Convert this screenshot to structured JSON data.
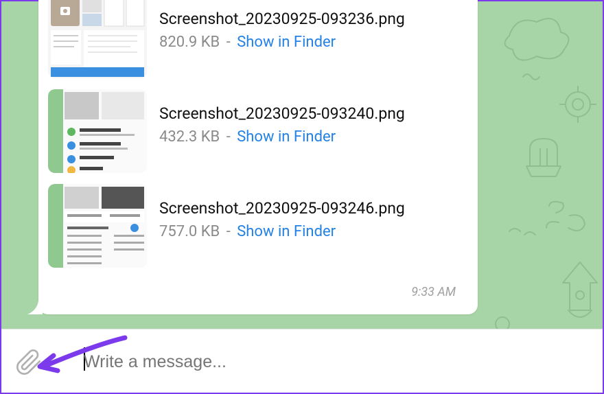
{
  "files": [
    {
      "name": "Screenshot_20230925-093236.png",
      "size": "820.9 KB",
      "action": "Show in Finder"
    },
    {
      "name": "Screenshot_20230925-093240.png",
      "size": "432.3 KB",
      "action": "Show in Finder"
    },
    {
      "name": "Screenshot_20230925-093246.png",
      "size": "757.0 KB",
      "action": "Show in Finder"
    }
  ],
  "timestamp": "9:33 AM",
  "composer": {
    "placeholder": "Write a message..."
  }
}
